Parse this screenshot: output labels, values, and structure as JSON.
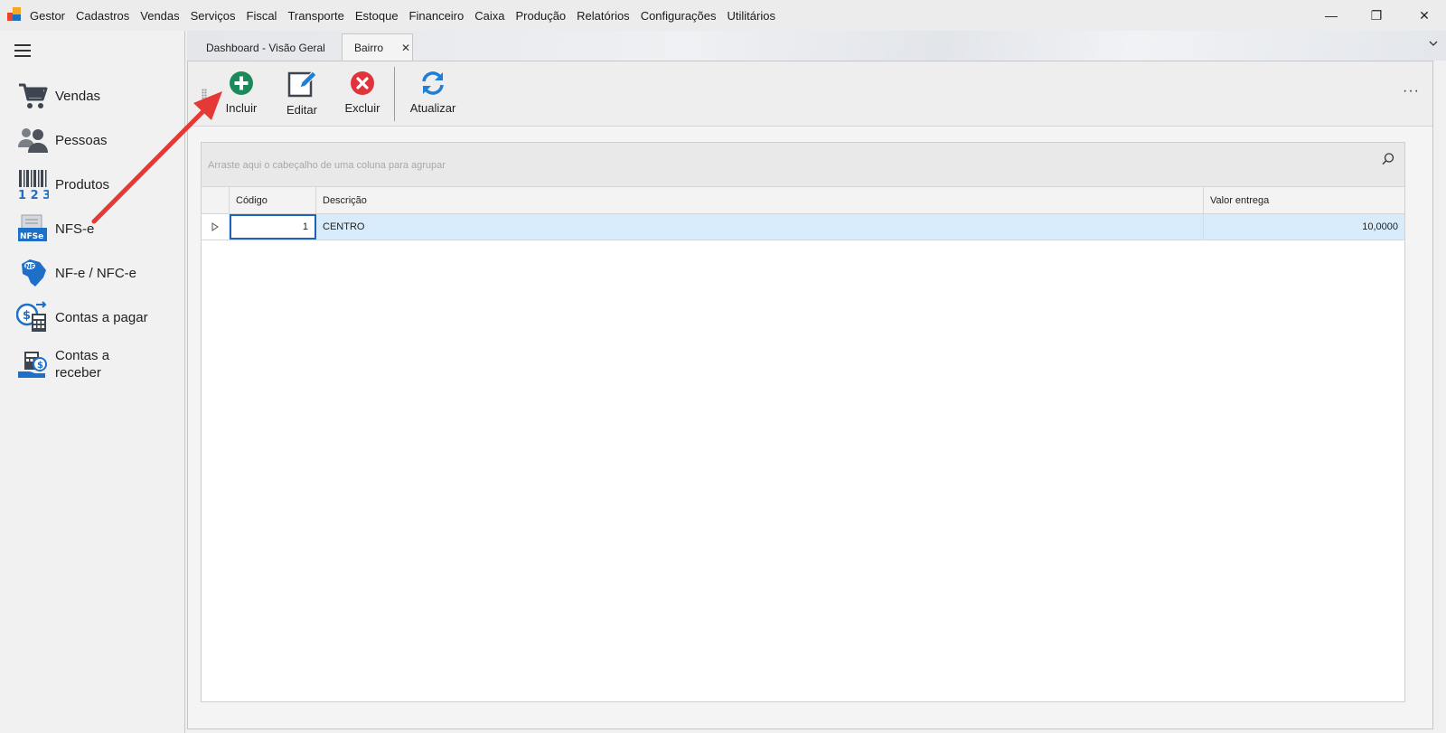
{
  "menu": [
    "Gestor",
    "Cadastros",
    "Vendas",
    "Serviços",
    "Fiscal",
    "Transporte",
    "Estoque",
    "Financeiro",
    "Caixa",
    "Produção",
    "Relatórios",
    "Configurações",
    "Utilitários"
  ],
  "window_controls": {
    "minimize": "—",
    "restore": "❐",
    "close": "✕"
  },
  "sidebar": {
    "items": [
      {
        "label": "Vendas",
        "icon": "cart-icon"
      },
      {
        "label": "Pessoas",
        "icon": "people-icon"
      },
      {
        "label": "Produtos",
        "icon": "barcode-icon"
      },
      {
        "label": "NFS-e",
        "icon": "nfse-icon"
      },
      {
        "label": "NF-e / NFC-e",
        "icon": "nfe-brazil-icon"
      },
      {
        "label": "Contas a pagar",
        "icon": "calculator-money-icon"
      },
      {
        "label": "Contas a receber",
        "icon": "hand-money-icon"
      }
    ]
  },
  "tabs": [
    {
      "label": "Dashboard - Visão Geral",
      "active": false
    },
    {
      "label": "Bairro",
      "active": true,
      "close": "✕"
    }
  ],
  "toolbar": {
    "incluir": "Incluir",
    "editar": "Editar",
    "excluir": "Excluir",
    "atualizar": "Atualizar",
    "more": "···"
  },
  "grid": {
    "group_hint": "Arraste aqui o cabeçalho de uma coluna para agrupar",
    "columns": [
      "Código",
      "Descrição",
      "Valor entrega"
    ],
    "rows": [
      {
        "codigo": "1",
        "descricao": "CENTRO",
        "valor_entrega": "10,0000"
      }
    ]
  },
  "colors": {
    "accent_add": "#1b8a5a",
    "accent_delete": "#e0333c",
    "accent_refresh": "#1e7fd6",
    "selection": "#d7ebfb",
    "annotation_arrow": "#e53935"
  }
}
